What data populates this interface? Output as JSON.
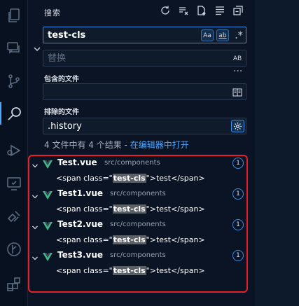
{
  "header": {
    "title": "搜索"
  },
  "search": {
    "value": "test-cls",
    "case_label": "Aa",
    "word_label": "ab",
    "regex_label": ".*"
  },
  "replace": {
    "placeholder": "替换",
    "preserve_label": "AB"
  },
  "include": {
    "label": "包含的文件",
    "value": ""
  },
  "exclude": {
    "label": "排除的文件",
    "value": ".history"
  },
  "summary": {
    "text": "4 文件中有 4 个结果 - ",
    "link": "在编辑器中打开"
  },
  "more": "···",
  "results": [
    {
      "file": "Test.vue",
      "path": "src/components",
      "count": "1",
      "pre": "<span class=\"",
      "match": "test-cls",
      "post": "\">test</span>"
    },
    {
      "file": "Test1.vue",
      "path": "src/components",
      "count": "1",
      "pre": "<span class=\"",
      "match": "test-cls",
      "post": "\">test</span>"
    },
    {
      "file": "Test2.vue",
      "path": "src/components",
      "count": "1",
      "pre": "<span class=\"",
      "match": "test-cls",
      "post": "\">test</span>"
    },
    {
      "file": "Test3.vue",
      "path": "src/components",
      "count": "1",
      "pre": "<span class=\"",
      "match": "test-cls",
      "post": "\">test</span>"
    }
  ],
  "colors": {
    "accent": "#4aa8ff",
    "vue_green": "#41b883",
    "highlight_border": "#e8202a"
  }
}
